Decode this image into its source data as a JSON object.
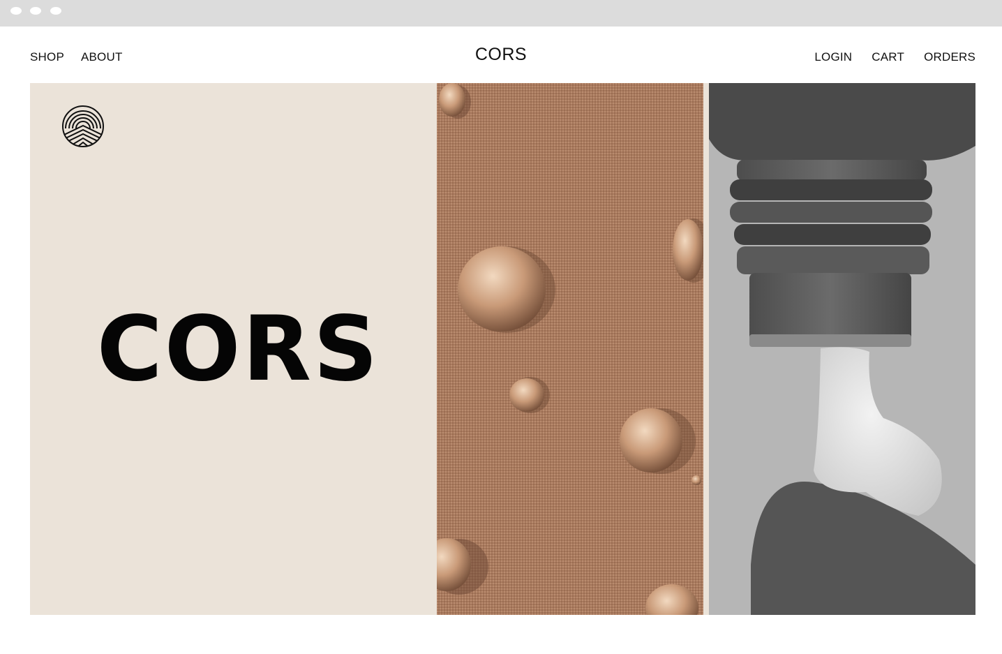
{
  "nav": {
    "left": [
      {
        "label": "SHOP"
      },
      {
        "label": "ABOUT"
      }
    ],
    "brand": "CORS",
    "right": [
      {
        "label": "LOGIN"
      },
      {
        "label": "CART"
      },
      {
        "label": "ORDERS"
      }
    ]
  },
  "hero": {
    "title": "CORS",
    "background_color": "#ebe3d9",
    "fabric_color": "#a97a5e",
    "tube_photo_tone": "grayscale"
  }
}
